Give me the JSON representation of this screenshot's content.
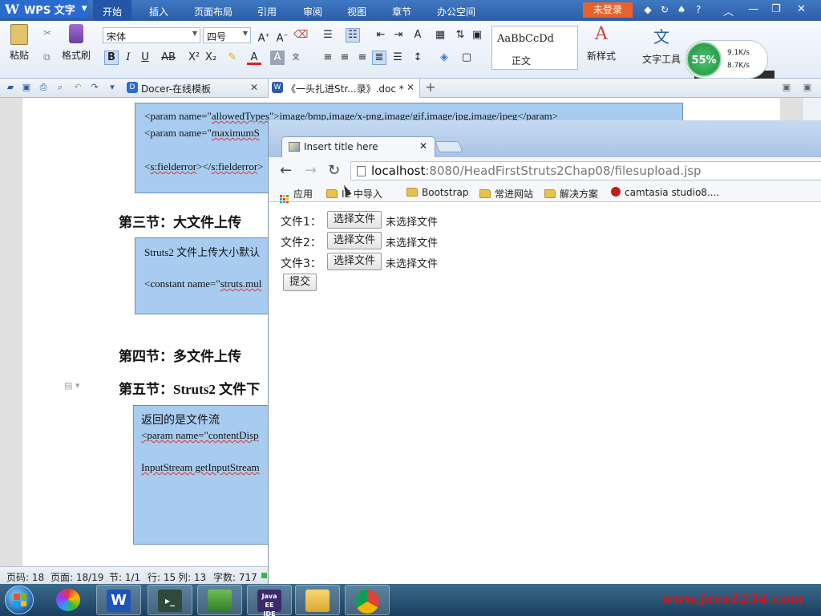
{
  "wps": {
    "app_name": "WPS 文字",
    "menus": [
      "开始",
      "插入",
      "页面布局",
      "引用",
      "审阅",
      "视图",
      "章节",
      "办公空间"
    ],
    "login_label": "未登录",
    "ribbon": {
      "paste_label": "粘贴",
      "format_painter_label": "格式刷",
      "font_name": "宋体",
      "font_size": "四号",
      "style_sample": "AaBbCcDd",
      "style_name": "正文",
      "new_style_label": "新样式",
      "text_tools_label": "文字工具"
    },
    "network": {
      "percent": "55%",
      "up": "9.1K/s",
      "down": "8.7K/s"
    },
    "tabs": [
      {
        "label": "Docer-在线模板"
      },
      {
        "label": "《一头扎进Str...录》.doc *"
      }
    ]
  },
  "document": {
    "box1": {
      "line1_parts": [
        "<param name=\"",
        "allowedTypes",
        "\">",
        "image/bmp,image/x-png,image/gif,image/jpg,image/jpeg",
        "</param>"
      ],
      "line2_parts": [
        "<param name=\"",
        "maximumS"
      ],
      "line3_parts": [
        "<",
        "s:fielderror",
        "></",
        "s:fielderror",
        ">"
      ]
    },
    "heading3": "第三节：大文件上传",
    "box2": {
      "line1": "Struts2 文件上传大小默认",
      "line2_parts": [
        "<constant name=\"",
        "struts.mul"
      ]
    },
    "heading4": "第四节：多文件上传",
    "heading5": "第五节：Struts2 文件下",
    "box3": {
      "line1": "返回的是文件流",
      "line2_parts": [
        "<param name=\"",
        "contentDisp"
      ],
      "line3": "InputStream getInputStream"
    }
  },
  "status": {
    "page_code": "页码: 18",
    "page": "页面: 18/19",
    "section": "节: 1/1",
    "row": "行: 15",
    "col": "列: 13",
    "words": "字数: 717"
  },
  "browser": {
    "tab_title": "Insert title here",
    "url_host": "localhost",
    "url_rest": ":8080/HeadFirstStruts2Chap08/filesupload.jsp",
    "bookmarks": [
      "应用",
      "IE 中导入",
      "Bootstrap",
      "常进网站",
      "解决方案",
      "camtasia studio8...."
    ],
    "form": {
      "rows": [
        {
          "label": "文件1：",
          "button": "选择文件",
          "state": "未选择文件"
        },
        {
          "label": "文件2：",
          "button": "选择文件",
          "state": "未选择文件"
        },
        {
          "label": "文件3：",
          "button": "选择文件",
          "state": "未选择文件"
        }
      ],
      "submit": "提交"
    }
  },
  "taskbar": {
    "watermark": "www.java1234.com"
  },
  "colors": {
    "wps_blue": "#2c5ea7",
    "login_orange": "#e8632b",
    "code_box": "#a8ccf0",
    "watermark_red": "#d8141b"
  }
}
